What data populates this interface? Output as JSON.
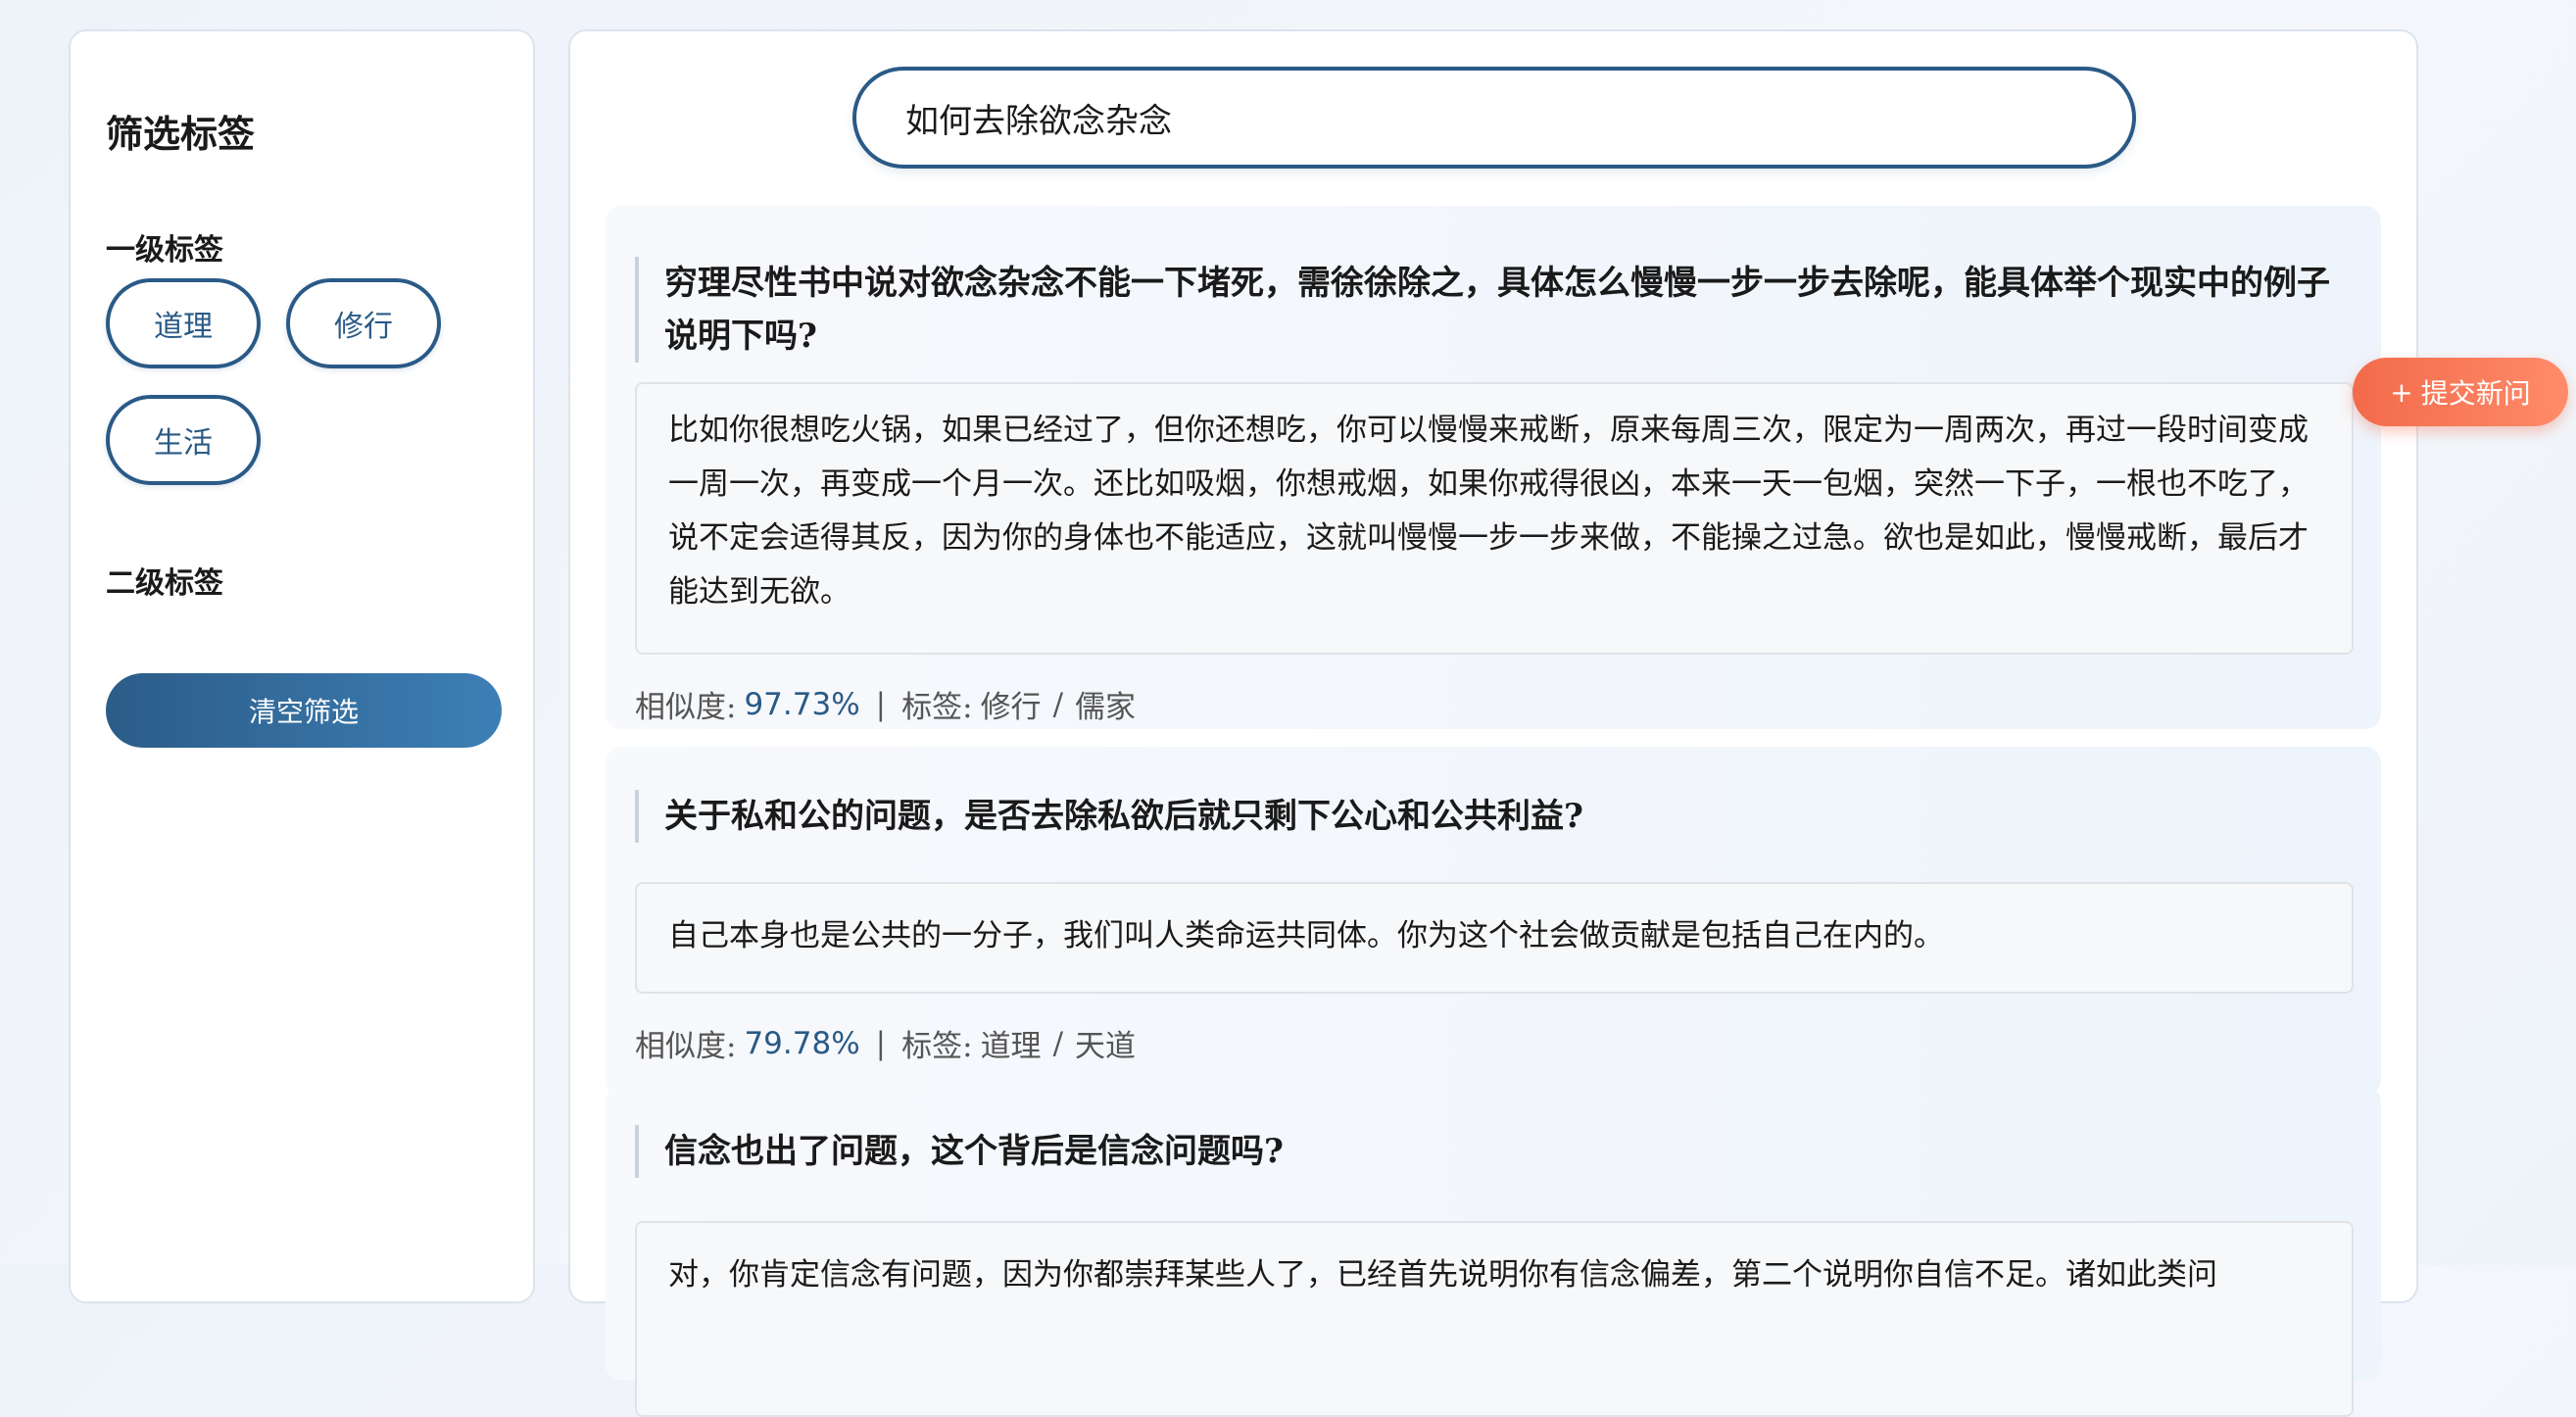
{
  "sidebar": {
    "title": "筛选标签",
    "level1_title": "一级标签",
    "level1_tags": [
      "道理",
      "修行",
      "生活"
    ],
    "level2_title": "二级标签",
    "clear_button": "清空筛选"
  },
  "search": {
    "value": "如何去除欲念杂念"
  },
  "submit_button": {
    "icon": "plus-icon",
    "icon_glyph": "+",
    "label": "提交新问"
  },
  "labels": {
    "similarity": "相似度:",
    "tags": "标签:",
    "separator": "|",
    "tag_separator": "/"
  },
  "results": [
    {
      "question": "穷理尽性书中说对欲念杂念不能一下堵死，需徐徐除之，具体怎么慢慢一步一步去除呢，能具体举个现实中的例子说明下吗?",
      "answer": "比如你很想吃火锅，如果已经过了，但你还想吃，你可以慢慢来戒断，原来每周三次，限定为一周两次，再过一段时间变成一周一次，再变成一个月一次。还比如吸烟，你想戒烟，如果你戒得很凶，本来一天一包烟，突然一下子，一根也不吃了，说不定会适得其反，因为你的身体也不能适应，这就叫慢慢一步一步来做，不能操之过急。欲也是如此，慢慢戒断，最后才能达到无欲。",
      "similarity": "97.73%",
      "tag1": "修行",
      "tag2": "儒家"
    },
    {
      "question": "关于私和公的问题，是否去除私欲后就只剩下公心和公共利益?",
      "answer": "自己本身也是公共的一分子，我们叫人类命运共同体。你为这个社会做贡献是包括自己在内的。",
      "similarity": "79.78%",
      "tag1": "道理",
      "tag2": "天道"
    },
    {
      "question": "信念也出了问题，这个背后是信念问题吗?",
      "answer": "对，你肯定信念有问题，因为你都崇拜某些人了，已经首先说明你有信念偏差，第二个说明你自信不足。诸如此类问"
    }
  ],
  "colors": {
    "accent": "#2a5a86",
    "submit": "#f26b4a",
    "background": "#eef3fa"
  }
}
